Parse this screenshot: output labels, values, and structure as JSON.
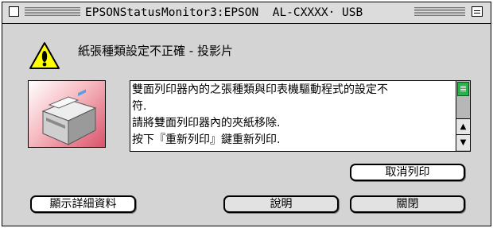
{
  "window": {
    "title_latin": "EPSONStatusMonitor3:EPSON",
    "title_model": "AL-CXXXX",
    "title_sep": "·",
    "title_port": "USB"
  },
  "alert": {
    "title": "紙張種類設定不正確 - 投影片",
    "lines": [
      "雙面列印器內的之張種類與印表機驅動程式的設定不",
      "符.",
      "請將雙面列印器內的夾紙移除.",
      "按下『重新列印』鍵重新列印."
    ]
  },
  "buttons": {
    "cancel_print": "取消列印",
    "show_details": "顯示詳細資料",
    "help": "說明",
    "close": "關閉"
  },
  "colors": {
    "scroll_thumb": "#27b24a",
    "warning_yellow": "#ffff00"
  },
  "icons": [
    "close-box-icon",
    "zoom-box-icon",
    "warning-icon",
    "printer-icon",
    "scroll-up-arrow-icon",
    "scroll-down-arrow-icon"
  ]
}
